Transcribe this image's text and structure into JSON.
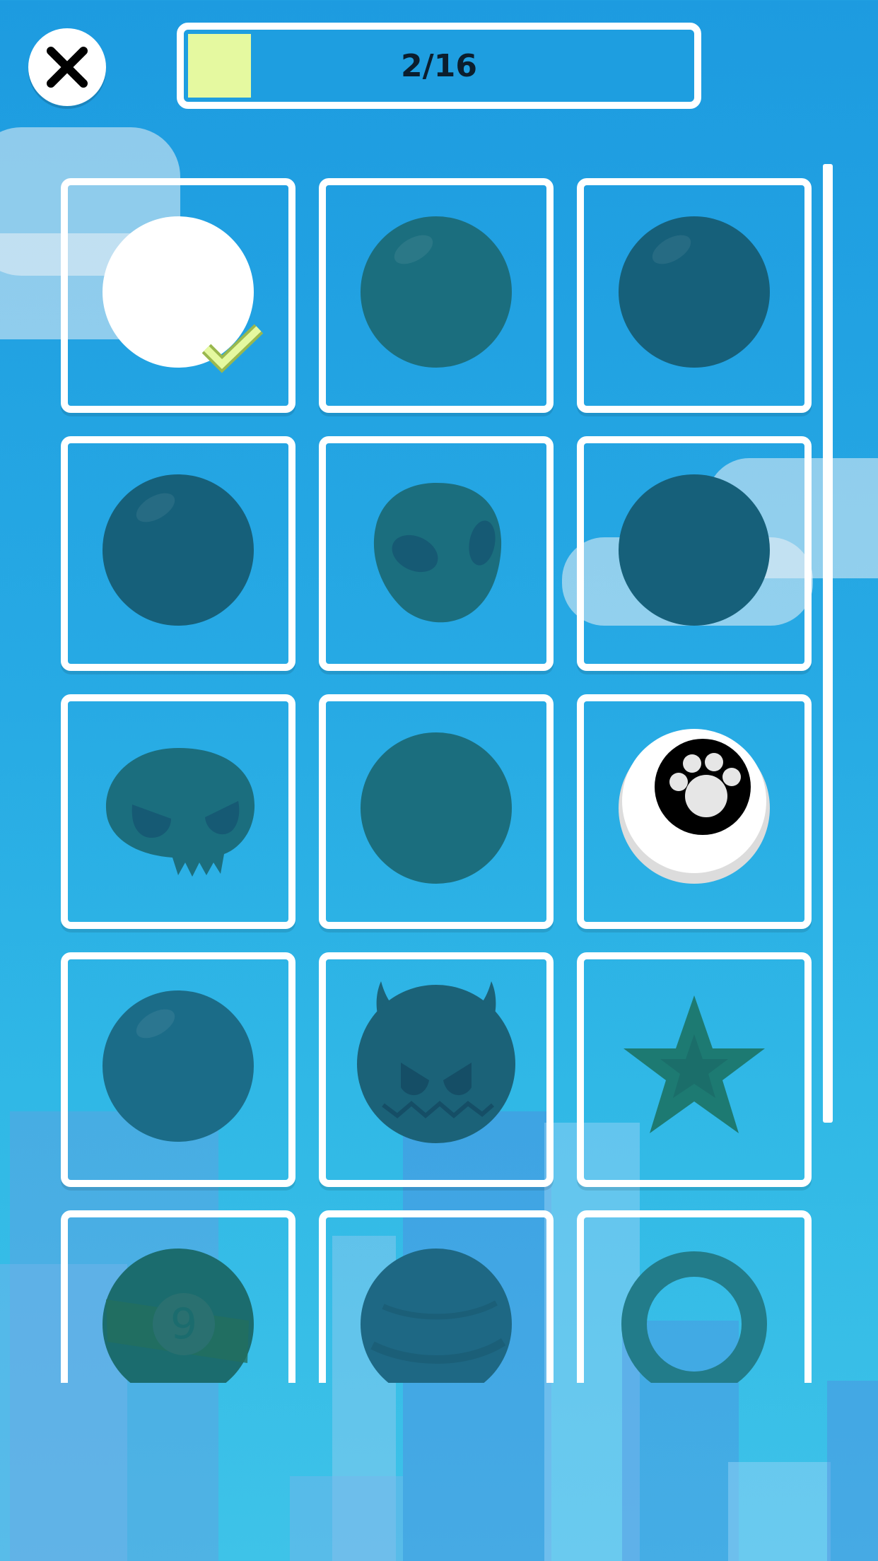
{
  "progress": {
    "label": "2/16",
    "unlocked": 2,
    "total": 16
  },
  "colors": {
    "locked_ball": "#1b6e80",
    "locked_dark": "#17607a",
    "selected_check": "#e5f9a0",
    "white": "#ffffff"
  },
  "skins": [
    {
      "icon": "white-ball-icon",
      "state": "unlocked",
      "selected": true
    },
    {
      "icon": "teal-ball-icon",
      "state": "locked"
    },
    {
      "icon": "dark-ball-icon",
      "state": "locked"
    },
    {
      "icon": "dark-ball-icon",
      "state": "locked"
    },
    {
      "icon": "alien-icon",
      "state": "locked"
    },
    {
      "icon": "dark-ball-icon",
      "state": "locked"
    },
    {
      "icon": "skull-icon",
      "state": "locked"
    },
    {
      "icon": "teal-ball-icon",
      "state": "locked"
    },
    {
      "icon": "paw-ball-icon",
      "state": "unlocked"
    },
    {
      "icon": "ball-icon",
      "state": "locked"
    },
    {
      "icon": "devil-icon",
      "state": "locked"
    },
    {
      "icon": "star-icon",
      "state": "locked"
    },
    {
      "icon": "billiard-nine-ball-icon",
      "state": "locked",
      "label": "9"
    },
    {
      "icon": "striped-ball-icon",
      "state": "locked"
    },
    {
      "icon": "ring-icon",
      "state": "locked"
    }
  ]
}
